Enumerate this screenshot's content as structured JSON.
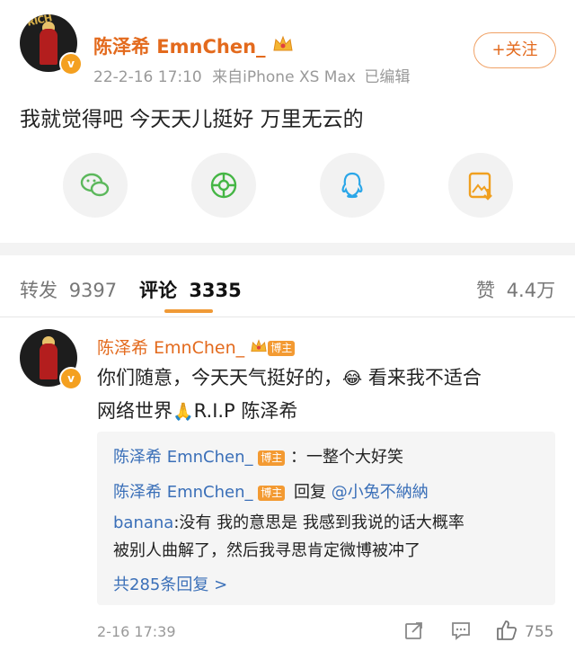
{
  "post": {
    "username": "陈泽希 EmnChen_",
    "crown_icon": "crown-icon",
    "verified_mark": "v",
    "timestamp": "22-2-16 17:10",
    "source": "来自iPhone XS Max",
    "edited": "已编辑",
    "follow_label": "+关注",
    "text": "我就觉得吧 今天天儿挺好 万里无云的",
    "avatar_logo_text": "RICH",
    "share_icons": [
      "wechat-icon",
      "moments-icon",
      "qq-icon",
      "save-image-icon"
    ]
  },
  "tabs": {
    "repost_label": "转发",
    "repost_count": "9397",
    "comment_label": "评论",
    "comment_count": "3335",
    "like_label": "赞",
    "like_count": "4.4万"
  },
  "comment": {
    "username": "陈泽希 EmnChen_",
    "author_tag": "博主",
    "text_part1": "你们随意，今天天气挺好的，",
    "emoji": "😂",
    "text_part2": " 看来我不适合",
    "text_line2_a": "网络世界",
    "pray_emoji": "🙏",
    "text_line2_b": "R.I.P 陈泽希",
    "replies": [
      {
        "name": "陈泽希 EmnChen_",
        "tag": "博主",
        "text": "：一整个大好笑"
      },
      {
        "name": "陈泽希 EmnChen_",
        "tag": "博主",
        "reply_word": "回复",
        "mention": "@小兔不納納"
      }
    ],
    "reply3_name": "banana",
    "reply3_line1": ":没有 我的意思是 我感到我说的话大概率",
    "reply3_line2": "被别人曲解了，然后我寻思肯定微博被冲了",
    "more_replies": "共285条回复 >",
    "time": "2-16 17:39",
    "like_count": "755"
  },
  "colors": {
    "brand_orange": "#e36a1d",
    "link_blue": "#3a6fb8",
    "tab_underline": "#f09a36"
  }
}
